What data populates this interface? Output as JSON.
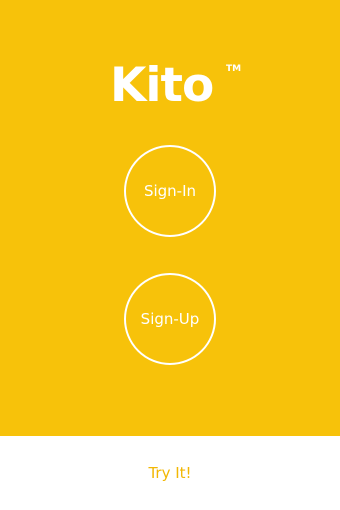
{
  "app": {
    "logo_text": "Kito",
    "trademark": "TM"
  },
  "buttons": {
    "sign_in": "Sign-In",
    "sign_up": "Sign-Up"
  },
  "footer": {
    "try_label": "Try It!"
  },
  "colors": {
    "brand_yellow": "#F7C20A",
    "text_on_brand": "#ffffff",
    "footer_link": "#F2B705",
    "footer_bg": "#ffffff"
  }
}
